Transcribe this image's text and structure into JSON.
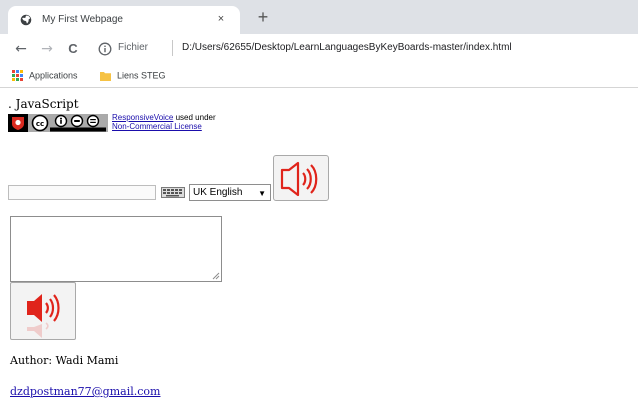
{
  "browser": {
    "tab": {
      "title": "My First Webpage",
      "close_symbol": "×"
    },
    "new_tab_symbol": "+",
    "nav": {
      "back": "←",
      "forward": "→",
      "reload": "C"
    },
    "address": {
      "scheme_label": "Fichier",
      "url": "D:/Users/62655/Desktop/LearnLanguagesByKeyBoards-master/index.html"
    },
    "bookmarks": [
      {
        "label": "Applications",
        "icon": "apps-grid-icon"
      },
      {
        "label": "Liens STEG",
        "icon": "folder-icon"
      }
    ]
  },
  "page": {
    "js_text": ". JavaScript",
    "attribution": {
      "link": "ResponsiveVoice",
      "mid": " used under",
      "license_link": "Non-Commercial License"
    },
    "language_select": {
      "value": "UK English",
      "options": [
        "UK English"
      ]
    },
    "author": "Author: Wadi Mami",
    "email": "dzdpostman77@gmail.com"
  },
  "colors": {
    "speaker_red": "#e0241b",
    "link_blue": "#1a0dab",
    "tabstrip_bg": "#dee1e6"
  }
}
